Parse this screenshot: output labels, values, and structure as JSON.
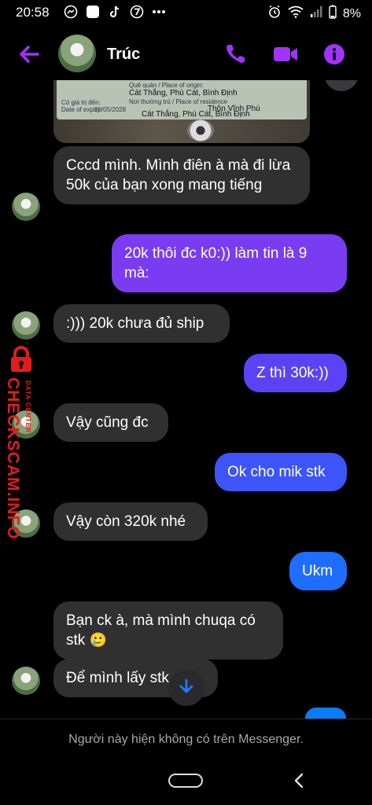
{
  "status_bar": {
    "time": "20:58",
    "battery": "8%",
    "left_icons": [
      "messenger-icon",
      "square-app-icon",
      "tiktok-icon",
      "seven-icon",
      "more-dots-icon"
    ],
    "right_icons": [
      "alarm-icon",
      "wifi-icon",
      "signal-icon",
      "battery-icon"
    ]
  },
  "header": {
    "contact_name": "Trúc",
    "accent_color": "#a033ff"
  },
  "id_card": {
    "origin_label": "Quê quán / Place of origin:",
    "origin_value": "Cát Thắng, Phù Cát, Bình Định",
    "residence_label": "Nơi thường trú / Place of residence",
    "residence_value1": "Thôn Vĩnh Phú",
    "residence_value2": "Cát Thắng, Phù Cát, Bình Định",
    "expiry_label": "Có giá trị đến:",
    "expiry_label2": "Date of expiry",
    "expiry_value": "10/05/2028"
  },
  "messages": [
    {
      "side": "in",
      "text": "Cccd mình. Mình điên à mà đi lừa 50k của bạn xong mang tiếng"
    },
    {
      "side": "out",
      "text": "20k thôi đc k0:)) làm tin là 9 mà:"
    },
    {
      "side": "in",
      "text": ":))) 20k chưa đủ ship"
    },
    {
      "side": "out",
      "text": "Z thì 30k:))"
    },
    {
      "side": "in",
      "text": "Vậy cũng đc"
    },
    {
      "side": "out",
      "text": "Ok cho mik stk"
    },
    {
      "side": "in",
      "text": "Vậy còn 320k nhé"
    },
    {
      "side": "out",
      "text": "Ukm"
    },
    {
      "side": "in",
      "text": "Bạn ck à, mà mình chuqa có stk",
      "emoji": "🥲"
    },
    {
      "side": "in",
      "text": "Để mình lấy stk đã"
    }
  ],
  "colors": {
    "outgoing_purple": "#7a3cf0",
    "outgoing_violet": "#5b43f5",
    "outgoing_blue": "#1f6dff",
    "incoming": "#303030"
  },
  "watermark": {
    "main": "CHECKSCAM.INFO",
    "small": "DATA CENTER"
  },
  "footer": {
    "notice": "Người này hiện không có trên Messenger."
  }
}
